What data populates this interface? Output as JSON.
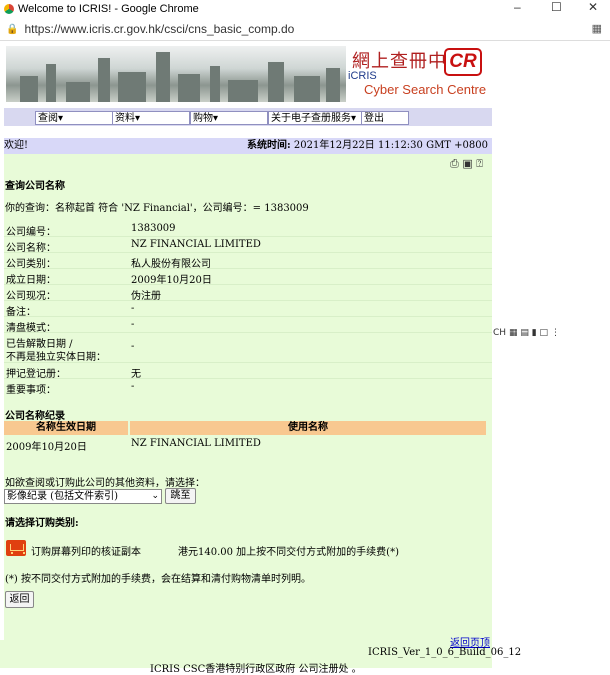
{
  "window": {
    "title": "Welcome to ICRIS! - Google Chrome",
    "controls": [
      "–",
      "☐",
      "✕"
    ]
  },
  "address": {
    "url": "https://www.icris.cr.gov.hk/csci/cns_basic_comp.do"
  },
  "banner": {
    "cn_title": "網上查冊中心",
    "cr_mark": "CR",
    "icris": "iCRIS",
    "en_title": "Cyber Search Centre"
  },
  "nav": [
    {
      "label": "查阅▾"
    },
    {
      "label": "资料▾"
    },
    {
      "label": "购物▾"
    },
    {
      "label": "关于电子查册服务▾"
    },
    {
      "label": "登出"
    }
  ],
  "welcome": {
    "greeting": "欢迎!",
    "time_label": "系统时间:",
    "time_value": " 2021年12月22日 11:12:30 GMT +0800"
  },
  "page": {
    "heading": "查询公司名称",
    "query_label": "你的查询：",
    "query_text": "名称起首 符合 'NZ Financial'，公司编号：= 1383009"
  },
  "details": [
    {
      "label": "公司编号：",
      "value": "1383009"
    },
    {
      "label": "公司名称：",
      "value": "NZ FINANCIAL LIMITED"
    },
    {
      "label": "公司类别：",
      "value": "私人股份有限公司"
    },
    {
      "label": "成立日期：",
      "value": "2009年10月20日"
    },
    {
      "label": "公司现况：",
      "value": "伪注册"
    },
    {
      "label": "备注：",
      "value": "-"
    },
    {
      "label": "清盘模式：",
      "value": "-"
    },
    {
      "label": "已告解散日期 /",
      "label2": "不再是独立实体日期：",
      "value": "-"
    },
    {
      "label": "押记登记册：",
      "value": "无"
    },
    {
      "label": "重要事项：",
      "value": "-"
    }
  ],
  "history": {
    "heading": "公司名称纪录",
    "col1": "名称生效日期",
    "col2": "使用名称",
    "row_date": "2009年10月20日",
    "row_name": "NZ FINANCIAL LIMITED"
  },
  "more": {
    "prompt": "如欲查阅或订购此公司的其他资料，请选择：",
    "selected": "影像纪录 (包括文件索引)",
    "go_button": "跳至"
  },
  "order": {
    "heading": "请选择订购类别:",
    "item_label": "订购屏幕列印的核证副本",
    "item_price": "港元140.00 加上按不同交付方式附加的手续费(*)",
    "note": "(*) 按不同交付方式附加的手续费，会在结算和清付购物清单时列明。",
    "back_button": "返回"
  },
  "footer": {
    "back_top": "返回页顶",
    "version": "ICRIS_Ver_1_0_6_Build_06_12",
    "copyright": "ICRIS CSC香港特别行政区政府 公司注册处 。"
  },
  "side_toolbar": {
    "label": "CH"
  }
}
